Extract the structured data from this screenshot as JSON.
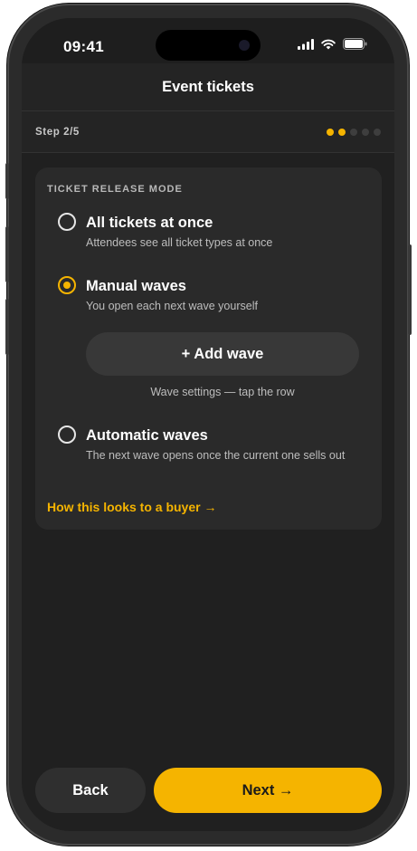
{
  "status_bar": {
    "time": "09:41"
  },
  "header": {
    "title": "Event tickets"
  },
  "stepper": {
    "label": "Step 2/5",
    "total": 5,
    "completed": 2,
    "active_color": "#f5b400",
    "inactive_color": "#3e3e3e"
  },
  "release_mode": {
    "section_label": "TICKET RELEASE MODE",
    "options": [
      {
        "title": "All tickets at once",
        "description": "Attendees see all ticket types at once",
        "selected": false
      },
      {
        "title": "Manual waves",
        "description": "You open each next wave yourself",
        "selected": true
      },
      {
        "title": "Automatic waves",
        "description": "The next wave opens once the current one sells out",
        "selected": false
      }
    ],
    "add_wave_label": "+ Add wave",
    "wave_hint": "Wave settings — tap the row",
    "buyer_link": "How this looks to a buyer →"
  },
  "footer": {
    "back_label": "Back",
    "next_label": "Next →"
  },
  "colors": {
    "accent": "#f5b400",
    "background": "#202020",
    "card": "#2a2a2a"
  }
}
